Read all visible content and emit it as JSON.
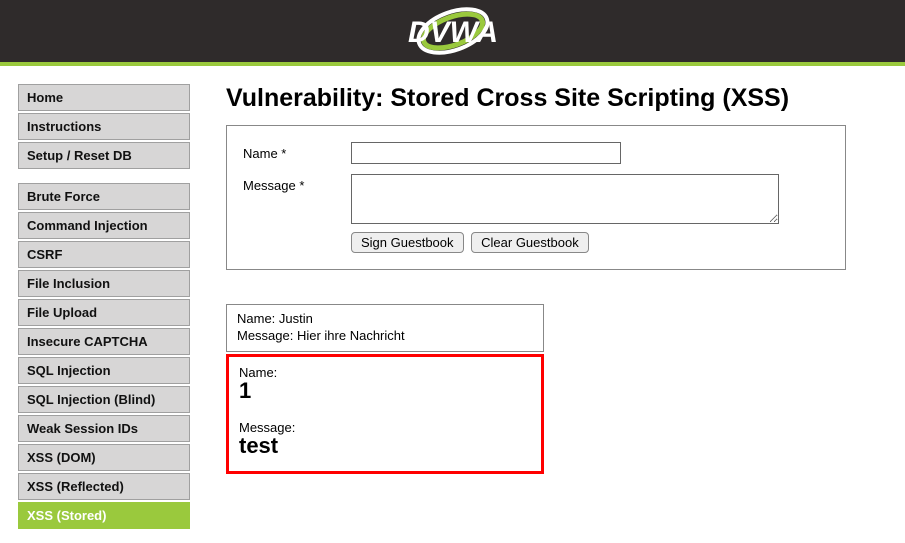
{
  "logo_text": "DVWA",
  "sidebar": {
    "group1": [
      {
        "label": "Home",
        "name": "nav-home"
      },
      {
        "label": "Instructions",
        "name": "nav-instructions"
      },
      {
        "label": "Setup / Reset DB",
        "name": "nav-setup"
      }
    ],
    "group2": [
      {
        "label": "Brute Force",
        "name": "nav-brute-force"
      },
      {
        "label": "Command Injection",
        "name": "nav-command-injection"
      },
      {
        "label": "CSRF",
        "name": "nav-csrf"
      },
      {
        "label": "File Inclusion",
        "name": "nav-file-inclusion"
      },
      {
        "label": "File Upload",
        "name": "nav-file-upload"
      },
      {
        "label": "Insecure CAPTCHA",
        "name": "nav-insecure-captcha"
      },
      {
        "label": "SQL Injection",
        "name": "nav-sql-injection"
      },
      {
        "label": "SQL Injection (Blind)",
        "name": "nav-sql-injection-blind"
      },
      {
        "label": "Weak Session IDs",
        "name": "nav-weak-session-ids"
      },
      {
        "label": "XSS (DOM)",
        "name": "nav-xss-dom"
      },
      {
        "label": "XSS (Reflected)",
        "name": "nav-xss-reflected"
      },
      {
        "label": "XSS (Stored)",
        "name": "nav-xss-stored",
        "active": true
      }
    ]
  },
  "page_title": "Vulnerability: Stored Cross Site Scripting (XSS)",
  "form": {
    "name_label": "Name *",
    "name_value": "",
    "message_label": "Message *",
    "message_value": "",
    "sign_button": "Sign Guestbook",
    "clear_button": "Clear Guestbook"
  },
  "guestbook": {
    "entry1": {
      "name_line": "Name: Justin",
      "message_line": "Message: Hier ihre Nachricht"
    },
    "highlight": {
      "name_label": "Name:",
      "name_value": "1",
      "message_label": "Message:",
      "message_value": "test"
    }
  }
}
